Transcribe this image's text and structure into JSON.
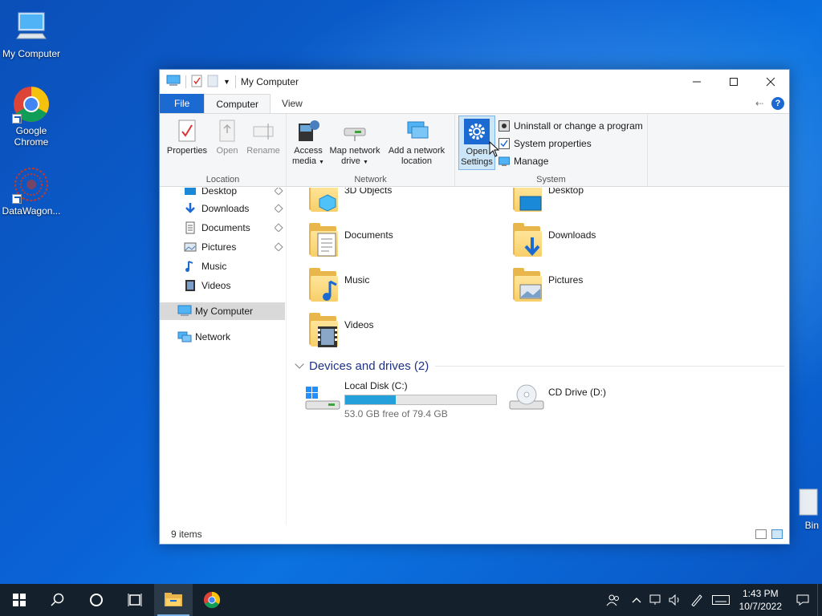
{
  "desktop": {
    "icons": [
      {
        "label": "My Computer"
      },
      {
        "label": "Google Chrome"
      },
      {
        "label": "DataWagon..."
      },
      {
        "label": "Bin"
      }
    ]
  },
  "window": {
    "title": "My Computer",
    "tabs": {
      "file": "File",
      "computer": "Computer",
      "view": "View"
    },
    "ribbon": {
      "location": {
        "label": "Location",
        "properties": "Properties",
        "open": "Open",
        "rename": "Rename"
      },
      "network": {
        "label": "Network",
        "access_media": "Access media",
        "map_drive": "Map network drive",
        "add_location": "Add a network location"
      },
      "system": {
        "label": "System",
        "open_settings": "Open Settings",
        "uninstall": "Uninstall or change a program",
        "system_properties": "System properties",
        "manage": "Manage"
      }
    },
    "nav": {
      "desktop": "Desktop",
      "downloads": "Downloads",
      "documents": "Documents",
      "pictures": "Pictures",
      "music": "Music",
      "videos": "Videos",
      "my_computer": "My Computer",
      "network": "Network"
    },
    "folders": {
      "objects3d": "3D Objects",
      "desktop": "Desktop",
      "documents": "Documents",
      "downloads": "Downloads",
      "music": "Music",
      "pictures": "Pictures",
      "videos": "Videos"
    },
    "devices_header": "Devices and drives (2)",
    "drives": {
      "c": {
        "name": "Local Disk (C:)",
        "free": "53.0 GB free of 79.4 GB",
        "used_fraction": 0.333
      },
      "d": {
        "name": "CD Drive (D:)"
      }
    },
    "status": "9 items"
  },
  "taskbar": {
    "time": "1:43 PM",
    "date": "10/7/2022"
  },
  "colors": {
    "accent": "#1a6ad2",
    "taskbar": "#14202b",
    "bar_fill": "#26a0da"
  }
}
